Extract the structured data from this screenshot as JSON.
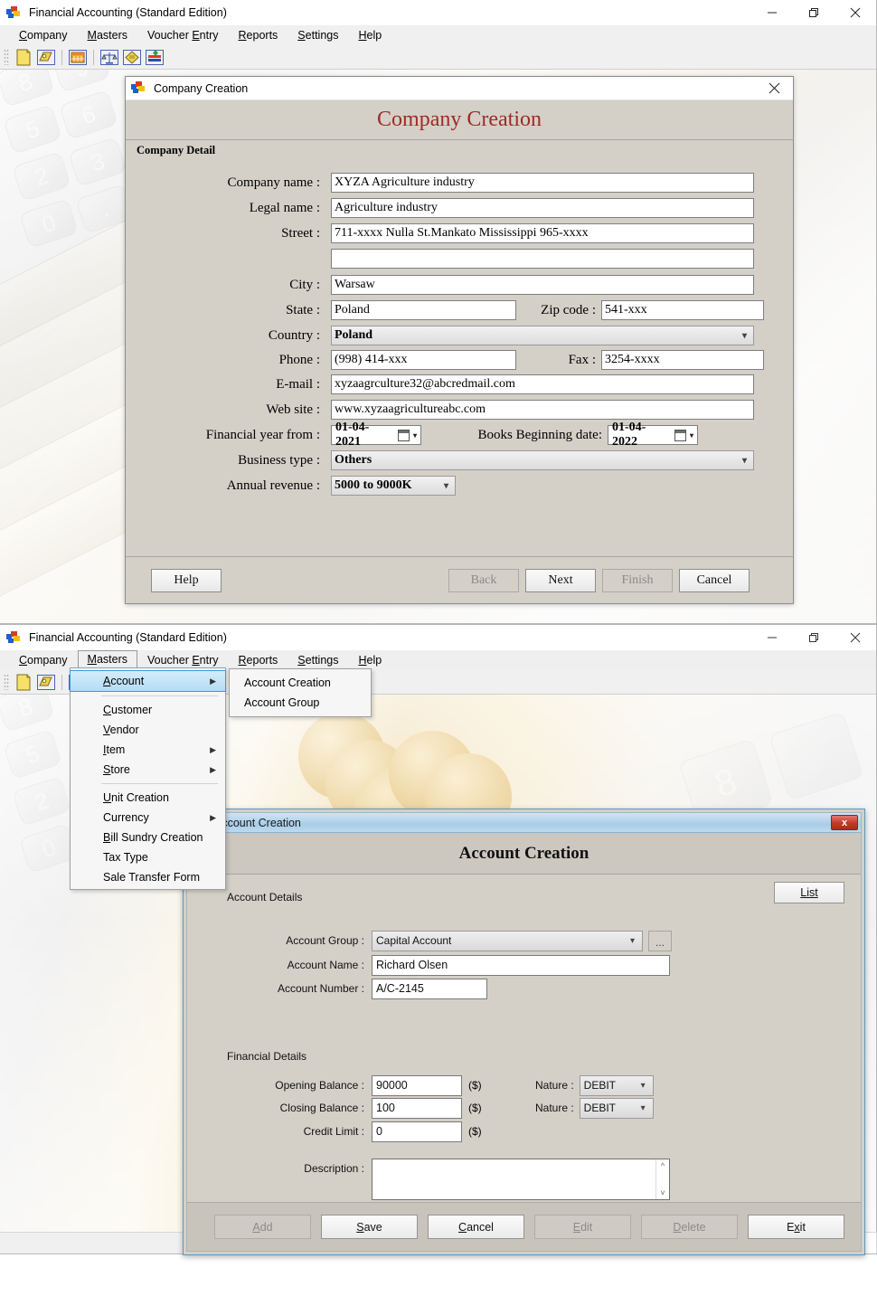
{
  "app": {
    "title": "Financial Accounting (Standard Edition)",
    "menus": [
      {
        "label": "Company",
        "mnemonic": "C"
      },
      {
        "label": "Masters",
        "mnemonic": "M"
      },
      {
        "label": "Voucher Entry",
        "mnemonic": "E"
      },
      {
        "label": "Reports",
        "mnemonic": "R"
      },
      {
        "label": "Settings",
        "mnemonic": "S"
      },
      {
        "label": "Help",
        "mnemonic": "H"
      }
    ],
    "window_controls": {
      "minimize": "—",
      "maximize": "❐",
      "close": "✕"
    },
    "toolbar_icons": [
      "new-document-icon",
      "open-folder-icon",
      "calendar-icon",
      "balance-scale-icon",
      "ledger-icon",
      "add-entry-icon"
    ]
  },
  "company_dialog": {
    "window_title": "Company Creation",
    "heading": "Company Creation",
    "group_label": "Company Detail",
    "fields": [
      {
        "label": "Company name :",
        "value": "XYZA Agriculture industry",
        "type": "text"
      },
      {
        "label": "Legal name :",
        "value": "Agriculture industry",
        "type": "text"
      },
      {
        "label": "Street :",
        "value": "711-xxxx Nulla St.Mankato Mississippi 965-xxxx",
        "type": "text"
      },
      {
        "label": "",
        "value": "",
        "type": "text"
      },
      {
        "label": "City :",
        "value": "Warsaw",
        "type": "text"
      },
      {
        "label": "State :",
        "value": "Poland",
        "type": "text"
      },
      {
        "label": "Country :",
        "value": "Poland",
        "type": "select"
      },
      {
        "label": "Phone :",
        "value": "(998) 414-xxx",
        "type": "text"
      },
      {
        "label": "E-mail :",
        "value": "xyzaagrculture32@abcredmail.com",
        "type": "text"
      },
      {
        "label": "Web site :",
        "value": "www.xyzaagricultureabc.com",
        "type": "text"
      },
      {
        "label": "Business type :",
        "value": "Others",
        "type": "select"
      },
      {
        "label": "Annual revenue :",
        "value": "5000 to 9000K",
        "type": "select"
      }
    ],
    "zip": {
      "label": "Zip code :",
      "value": "541-xxx"
    },
    "fax": {
      "label": "Fax :",
      "value": "3254-xxxx"
    },
    "financial_year": {
      "label": "Financial year from :",
      "value": "01-04-2021"
    },
    "books_beginning": {
      "label": "Books Beginning date:",
      "value": "01-04-2022"
    },
    "buttons": [
      {
        "label": "Help",
        "enabled": true
      },
      {
        "label": "Back",
        "enabled": false
      },
      {
        "label": "Next",
        "enabled": true
      },
      {
        "label": "Finish",
        "enabled": false
      },
      {
        "label": "Cancel",
        "enabled": true
      }
    ]
  },
  "masters_menu": {
    "items": [
      {
        "label": "Account",
        "mnemonic": "A",
        "submenu": true,
        "highlighted": true
      },
      {
        "separator": true
      },
      {
        "label": "Customer",
        "mnemonic": "C",
        "submenu": false
      },
      {
        "label": "Vendor",
        "mnemonic": "V",
        "submenu": false
      },
      {
        "label": "Item",
        "mnemonic": "I",
        "submenu": true
      },
      {
        "label": "Store",
        "mnemonic": "S",
        "submenu": true
      },
      {
        "separator": true
      },
      {
        "label": "Unit Creation",
        "mnemonic": "U",
        "submenu": false
      },
      {
        "label": "Currency",
        "mnemonic": "",
        "submenu": true
      },
      {
        "label": "Bill Sundry Creation",
        "mnemonic": "B",
        "submenu": false
      },
      {
        "label": "Tax Type",
        "mnemonic": "",
        "submenu": false
      },
      {
        "label": "Sale Transfer Form",
        "mnemonic": "",
        "submenu": false
      }
    ],
    "submenu": {
      "items": [
        {
          "label": "Account Creation"
        },
        {
          "label": "Account Group"
        }
      ]
    }
  },
  "account_dialog": {
    "window_title": "Account Creation",
    "heading": "Account Creation",
    "close_label": "x",
    "list_button": "List",
    "sections": {
      "account_details": "Account Details",
      "financial_details": "Financial Details"
    },
    "fields": {
      "account_group": {
        "label": "Account Group :",
        "value": "Capital Account",
        "ellipsis": "..."
      },
      "account_name": {
        "label": "Account Name :",
        "value": "Richard Olsen"
      },
      "account_number": {
        "label": "Account Number :",
        "value": "A/C-2145"
      },
      "opening_balance": {
        "label": "Opening Balance :",
        "value": "90000",
        "currency": "($)"
      },
      "closing_balance": {
        "label": "Closing Balance :",
        "value": "100",
        "currency": "($)"
      },
      "credit_limit": {
        "label": "Credit Limit :",
        "value": "0",
        "currency": "($)"
      },
      "nature_opening": {
        "label": "Nature :",
        "value": "DEBIT"
      },
      "nature_closing": {
        "label": "Nature :",
        "value": "DEBIT"
      },
      "description": {
        "label": "Description :",
        "value": ""
      }
    },
    "buttons": [
      {
        "label": "Add",
        "mnemonic": "A",
        "enabled": false
      },
      {
        "label": "Save",
        "mnemonic": "S",
        "enabled": true
      },
      {
        "label": "Cancel",
        "mnemonic": "C",
        "enabled": true
      },
      {
        "label": "Edit",
        "mnemonic": "E",
        "enabled": false
      },
      {
        "label": "Delete",
        "mnemonic": "D",
        "enabled": false
      },
      {
        "label": "Exit",
        "mnemonic": "x",
        "enabled": true
      }
    ]
  },
  "colors": {
    "heading_red": "#9e2b26",
    "dialog_face": "#d4d0c8",
    "menu_highlight": "#b3ddf6",
    "close_red": "#c0392b"
  }
}
